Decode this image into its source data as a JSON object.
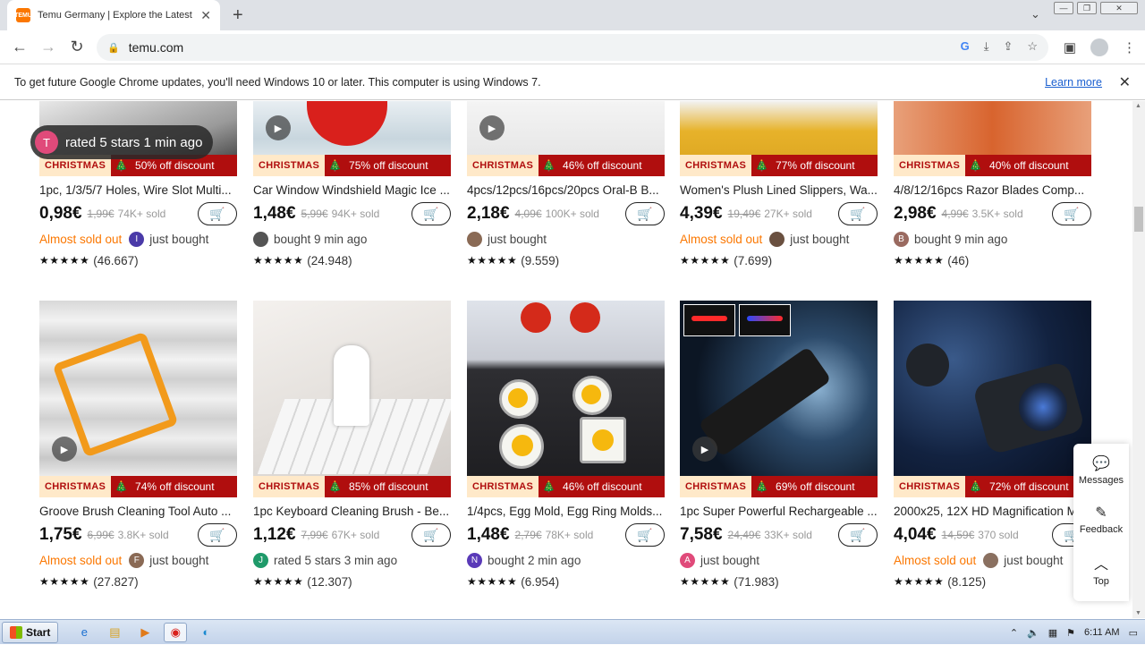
{
  "browser": {
    "tab_title": "Temu Germany | Explore the Latest Clothing",
    "tab_favicon_text": "TEMU",
    "url": "temu.com",
    "new_tab_symbol": "+",
    "window_buttons": [
      "—",
      "❐",
      "✕"
    ]
  },
  "infobar": {
    "message": "To get future Google Chrome updates, you'll need Windows 10 or later. This computer is using Windows 7.",
    "learn_more": "Learn more"
  },
  "toast": {
    "initial": "T",
    "text": "rated 5 stars 1 min ago"
  },
  "banner_label": "CHRISTMAS",
  "row1": [
    {
      "discount": "50% off discount",
      "name": "1pc, 1/3/5/7 Holes, Wire Slot Multi...",
      "price": "0,98€",
      "old_price": "1,99€",
      "sold": "74K+ sold",
      "almost": "Almost sold out",
      "avatar": "I",
      "avatar_color": "#4a3aa8",
      "social": "just bought",
      "stars": "★★★★★",
      "reviews": "(46.667)"
    },
    {
      "discount": "75% off discount",
      "name": "Car Window Windshield Magic Ice ...",
      "price": "1,48€",
      "old_price": "5,99€",
      "sold": "94K+ sold",
      "almost": "",
      "avatar": "",
      "avatar_color": "#555555",
      "social": "bought 9 min ago",
      "stars": "★★★★★",
      "reviews": "(24.948)"
    },
    {
      "discount": "46% off discount",
      "name": "4pcs/12pcs/16pcs/20pcs Oral-B B...",
      "price": "2,18€",
      "old_price": "4,09€",
      "sold": "100K+ sold",
      "almost": "",
      "avatar": "",
      "avatar_color": "#8a6a55",
      "social": "just bought",
      "stars": "★★★★★",
      "reviews": "(9.559)"
    },
    {
      "discount": "77% off discount",
      "name": "Women's Plush Lined Slippers, Wa...",
      "price": "4,39€",
      "old_price": "19,49€",
      "sold": "27K+ sold",
      "almost": "Almost sold out",
      "avatar": "",
      "avatar_color": "#6a5040",
      "social": "just bought",
      "stars": "★★★★★",
      "reviews": "(7.699)"
    },
    {
      "discount": "40% off discount",
      "name": "4/8/12/16pcs Razor Blades Comp...",
      "price": "2,98€",
      "old_price": "4,99€",
      "sold": "3.5K+ sold",
      "almost": "",
      "avatar": "B",
      "avatar_color": "#9a6a60",
      "social": "bought 9 min ago",
      "stars": "★★★★★",
      "reviews": "(46)"
    }
  ],
  "row2": [
    {
      "discount": "74% off discount",
      "name": "Groove Brush Cleaning Tool Auto ...",
      "price": "1,75€",
      "old_price": "6,99€",
      "sold": "3.8K+ sold",
      "almost": "Almost sold out",
      "avatar": "F",
      "avatar_color": "#8a6a55",
      "social": "just bought",
      "stars": "★★★★★",
      "reviews": "(27.827)"
    },
    {
      "discount": "85% off discount",
      "name": "1pc Keyboard Cleaning Brush - Be...",
      "price": "1,12€",
      "old_price": "7,99€",
      "sold": "67K+ sold",
      "almost": "",
      "avatar": "J",
      "avatar_color": "#1f9a6a",
      "social": "rated 5 stars 3 min ago",
      "stars": "★★★★★",
      "reviews": "(12.307)"
    },
    {
      "discount": "46% off discount",
      "name": "1/4pcs, Egg Mold, Egg Ring Molds...",
      "price": "1,48€",
      "old_price": "2,79€",
      "sold": "78K+ sold",
      "almost": "",
      "avatar": "N",
      "avatar_color": "#5a3ab8",
      "social": "bought 2 min ago",
      "stars": "★★★★★",
      "reviews": "(6.954)"
    },
    {
      "discount": "69% off discount",
      "name": "1pc Super Powerful Rechargeable ...",
      "price": "7,58€",
      "old_price": "24,49€",
      "sold": "33K+ sold",
      "almost": "",
      "avatar": "A",
      "avatar_color": "#e04a7a",
      "social": "just bought",
      "stars": "★★★★★",
      "reviews": "(71.983)"
    },
    {
      "discount": "72% off discount",
      "name": "2000x25, 12X HD Magnification M...",
      "price": "4,04€",
      "old_price": "14,59€",
      "sold": "370 sold",
      "almost": "Almost sold out",
      "avatar": "",
      "avatar_color": "#8a7060",
      "social": "just bought",
      "stars": "★★★★★",
      "reviews": "(8.125)"
    }
  ],
  "sidepanel": {
    "messages": "Messages",
    "feedback": "Feedback",
    "top": "Top"
  },
  "taskbar": {
    "start": "Start",
    "time": "6:11 AM"
  }
}
